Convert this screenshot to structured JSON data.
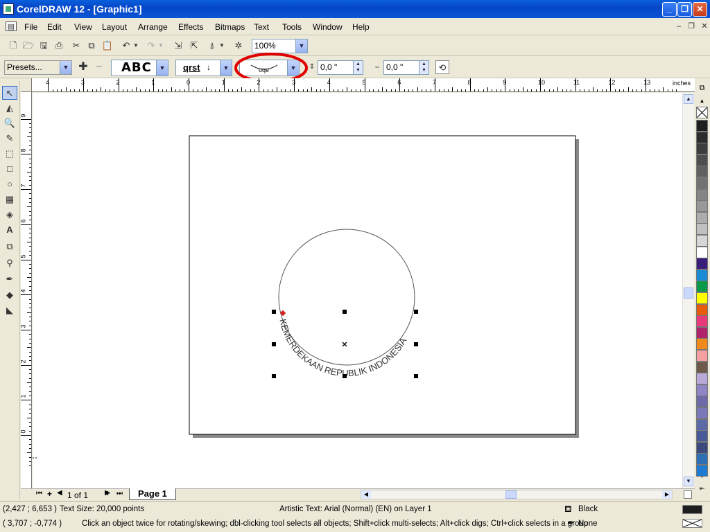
{
  "window": {
    "title": "CorelDRAW 12 - [Graphic1]"
  },
  "menu": [
    "File",
    "Edit",
    "View",
    "Layout",
    "Arrange",
    "Effects",
    "Bitmaps",
    "Text",
    "Tools",
    "Window",
    "Help"
  ],
  "toolbar": {
    "zoom": "100%"
  },
  "propbar": {
    "presets": "Presets...",
    "preview_abc": "ABC",
    "orientation_text": "qrst",
    "distance_from_path": "0,0 \"",
    "horizontal_offset": "0,0 \""
  },
  "ruler": {
    "unit_label": "inches",
    "horizontal_ticks": [
      "4",
      "3",
      "2",
      "1",
      "0",
      "1",
      "2",
      "3",
      "4",
      "5",
      "6",
      "7",
      "8",
      "9",
      "10",
      "11",
      "12",
      "13"
    ],
    "vertical_ticks": [
      "9",
      "8",
      "7",
      "6",
      "5",
      "4",
      "3",
      "2",
      "1",
      "0"
    ]
  },
  "drawing": {
    "path_text": "KEMERDEKAAN REPUBLIK INDONESIA"
  },
  "page_nav": {
    "count": "1 of 1",
    "tab": "Page 1"
  },
  "status": {
    "cursor_position": "(2,427 ; 6,653 )",
    "text_size": "Text Size: 20,000 points",
    "object_info": "Artistic Text: Arial (Normal) (EN) on Layer 1",
    "fill_label": "Black",
    "coords2": "( 3,707 ; -0,774 )",
    "hint": "Click an object twice for rotating/skewing; dbl-clicking tool selects all objects; Shift+click multi-selects; Alt+click digs; Ctrl+click selects in a group",
    "outline_label": "None"
  },
  "colors": {
    "highlight_circle": "#e00000",
    "palette": [
      "#1e1e1e",
      "#2c2c2c",
      "#3d3d3d",
      "#4e4e4e",
      "#606060",
      "#727272",
      "#858585",
      "#989898",
      "#acacac",
      "#c0c0c0",
      "#d6d6d6",
      "#ffffff",
      "#3a1f7a",
      "#1a8ad4",
      "#0c9a4a",
      "#ffff00",
      "#e85a0c",
      "#e8397a",
      "#b0246c",
      "#f08a1c",
      "#f4a0a0",
      "#6e5a4a",
      "#b8a8d8",
      "#8f84c4",
      "#6e6aa8",
      "#7a78b8",
      "#5a6aa8",
      "#485a98",
      "#3a4a7c",
      "#2e6eb4",
      "#1e7ad0"
    ]
  }
}
